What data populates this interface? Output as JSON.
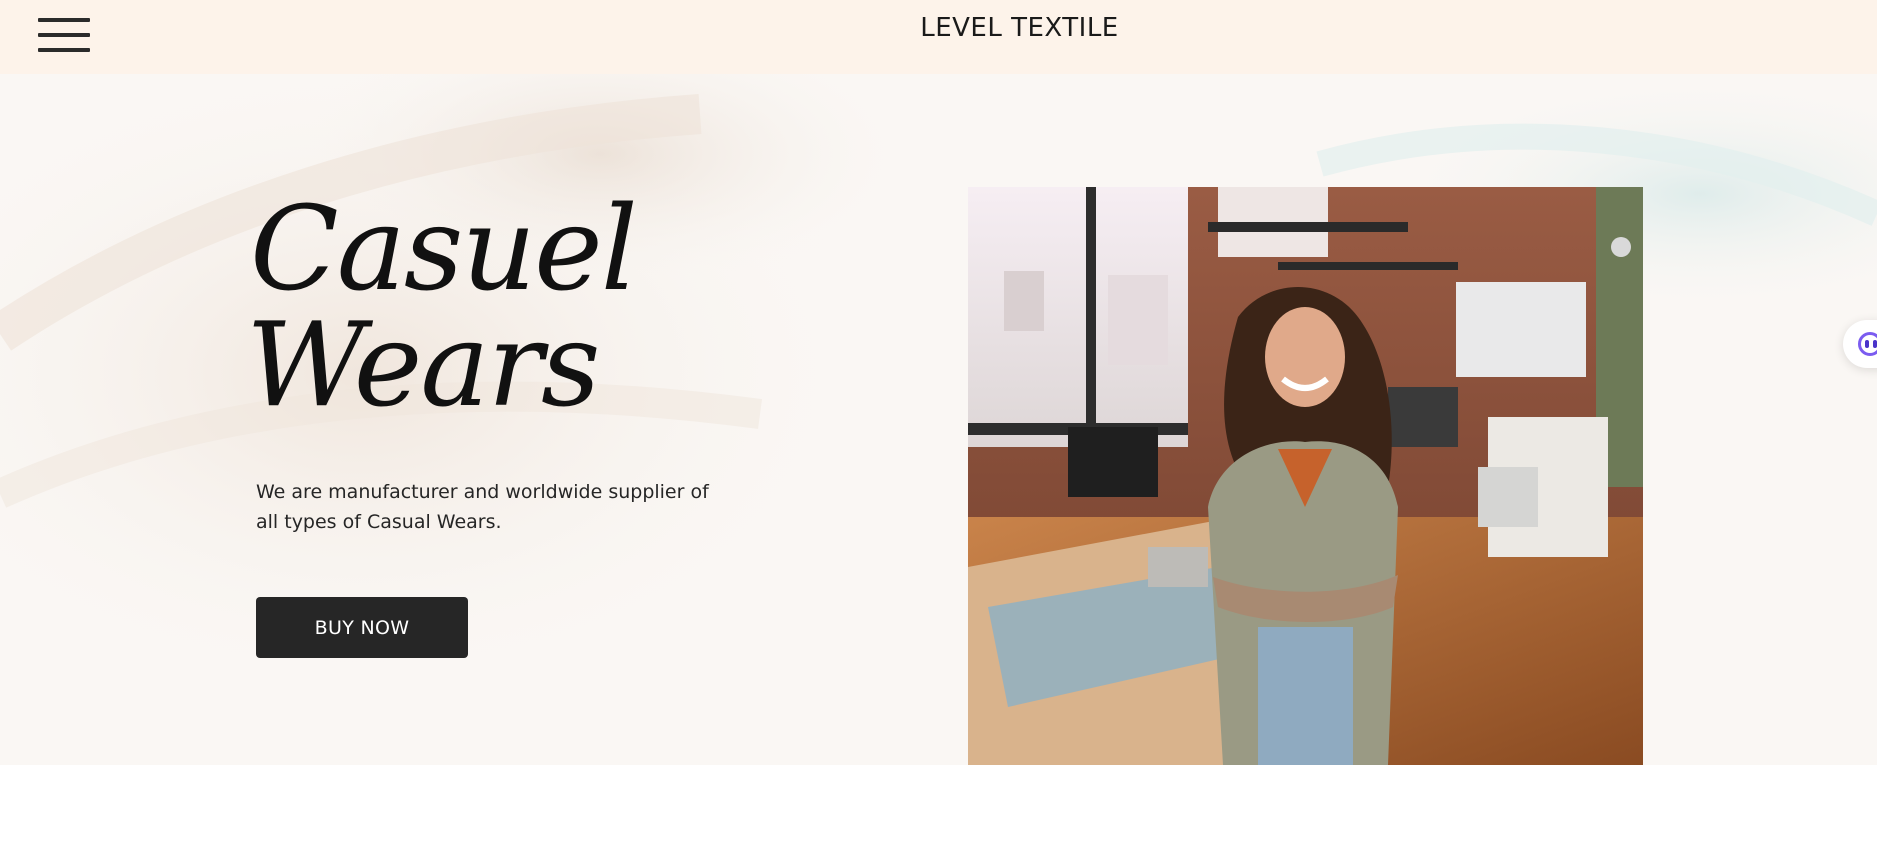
{
  "header": {
    "brand": "LEVEL TEXTILE",
    "menu_icon": "hamburger-menu-icon",
    "background": "#fdf3ea"
  },
  "hero": {
    "title_line1": "Casuel",
    "title_line2": "Wears",
    "description": "We are manufacturer and worldwide supplier of all types of Casual Wears.",
    "cta_label": "BUY NOW",
    "cta_color": "#262626",
    "image_alt": "Smiling woman with arms crossed standing in a workshop office"
  },
  "side_widget": {
    "icon": "assistant-chat-icon"
  }
}
